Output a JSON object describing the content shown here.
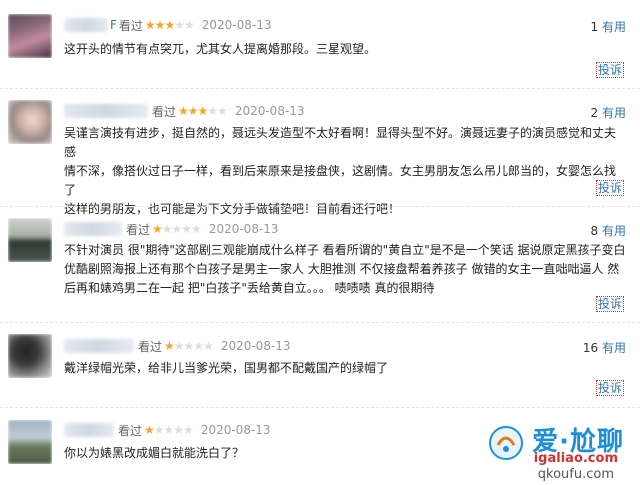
{
  "reviews": [
    {
      "name_tail": "F",
      "label": "看过",
      "stars_on": "★★★",
      "stars_off": "★★",
      "date": "2020-08-13",
      "useful_count": "1",
      "useful_label": "有用",
      "lines": [
        "这开头的情节有点突兀，尤其女人提离婚那段。三星观望。"
      ],
      "report": "投诉"
    },
    {
      "name_tail": "",
      "label": "看过",
      "stars_on": "★★★",
      "stars_off": "★★",
      "date": "2020-08-13",
      "useful_count": "2",
      "useful_label": "有用",
      "lines": [
        "吴谨言演技有进步，挺自然的，聂远头发造型不太好看啊！显得头型不好。演聂远妻子的演员感觉和丈夫感",
        "情不深，像搭伙过日子一样，看到后来原来是接盘侠，这剧情。女主男朋友怎么吊儿郎当的，女婴怎么找了",
        "这样的男朋友，也可能是为下文分手做铺垫吧！目前看还行吧！"
      ],
      "report": "投诉"
    },
    {
      "name_tail": "",
      "label": "看过",
      "stars_on": "★",
      "stars_off": "★★★★",
      "date": "2020-08-13",
      "useful_count": "8",
      "useful_label": "有用",
      "lines": [
        "不针对演员 很\"期待\"这部剧三观能崩成什么样子 看看所谓的\"黄自立\"是不是一个笑话 据说原定黑孩子变白",
        "优酷剧照海报上还有那个白孩子是男主一家人 大胆推测 不仅接盘帮着养孩子 做错的女主一直咄咄逼人 然",
        "后再和婊鸡男二在一起 把\"白孩子\"丢给黄自立。。。 啧啧啧 真的很期待"
      ],
      "report": "投诉"
    },
    {
      "name_tail": "",
      "label": "看过",
      "stars_on": "★",
      "stars_off": "★★★★",
      "date": "2020-08-13",
      "useful_count": "16",
      "useful_label": "有用",
      "lines": [
        "戴洋绿帽光荣，给非儿当爹光荣，国男都不配戴国产的绿帽了"
      ],
      "report": "投诉"
    },
    {
      "name_tail": "",
      "label": "看过",
      "stars_on": "★",
      "stars_off": "★★★★",
      "date": "2020-08-13",
      "useful_count": "",
      "useful_label": "",
      "lines": [
        "你以为婊黑改成媚白就能洗白了？"
      ],
      "report": ""
    }
  ],
  "watermark": {
    "title": "爱·尬聊",
    "url1": "igaliao.com",
    "url2": "qkoufu.com"
  },
  "colors": {
    "star": "#f5a623",
    "link": "#3377aa",
    "report_border": "#cc3333"
  }
}
